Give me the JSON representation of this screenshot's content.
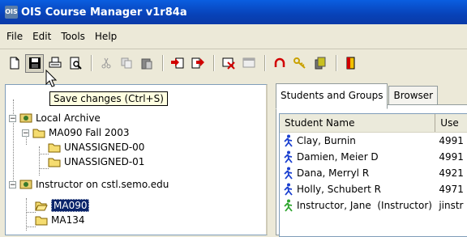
{
  "window": {
    "title": "OIS Course Manager v1r84a",
    "icon_label": "OIS"
  },
  "menu": [
    "File",
    "Edit",
    "Tools",
    "Help"
  ],
  "tooltip": "Save changes (Ctrl+S)",
  "tree": {
    "items": [
      {
        "label": "Local Archive",
        "level": 0
      },
      {
        "label": "MA090 Fall 2003",
        "level": 1
      },
      {
        "label": "UNASSIGNED-00",
        "level": 2
      },
      {
        "label": "UNASSIGNED-01",
        "level": 2
      },
      {
        "label": "Instructor on cstl.semo.edu",
        "level": 0
      },
      {
        "label": "MA090",
        "level": 1,
        "selected": true
      },
      {
        "label": "MA134",
        "level": 1
      }
    ]
  },
  "tabs": [
    "Students and Groups",
    "Browser"
  ],
  "table": {
    "headers": [
      "Student Name",
      "Use"
    ],
    "rows": [
      {
        "name": "Clay, Burnin",
        "user": "4991"
      },
      {
        "name": "Damien, Meier D",
        "user": "4991"
      },
      {
        "name": "Dana, Merryl R",
        "user": "4921"
      },
      {
        "name": "Holly, Schubert R",
        "user": "4971"
      },
      {
        "name": "Instructor, Jane  (Instructor)",
        "user": "jinstr"
      }
    ]
  },
  "colors": {
    "title_bar": "#0842b8",
    "selection": "#0a246a",
    "student_icon": "#1a3fcf",
    "instructor_icon": "#2ea52e"
  }
}
